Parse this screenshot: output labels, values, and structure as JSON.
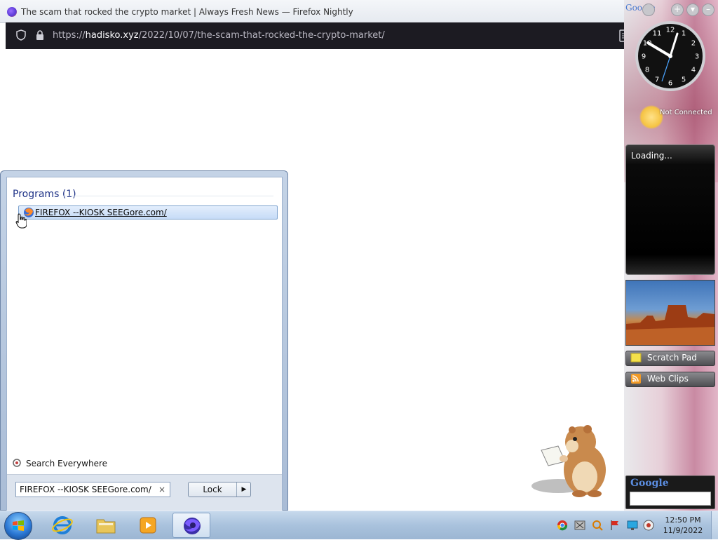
{
  "browser": {
    "window_title": "The scam that rocked the crypto market | Always Fresh News — Firefox Nightly",
    "url_prefix": "https://",
    "url_host": "hadisko.xyz",
    "url_path": "/2022/10/07/the-scam-that-rocked-the-crypto-market/"
  },
  "sidebar": {
    "google_tiny": "Google",
    "clock_numbers": [
      "12",
      "1",
      "2",
      "3",
      "4",
      "5",
      "6",
      "7",
      "8",
      "9",
      "10",
      "11"
    ],
    "weather_status": "Not Connected",
    "feed_status": "Loading...",
    "gadgets": [
      {
        "label": "Scratch Pad",
        "icon": "note-icon"
      },
      {
        "label": "Web Clips",
        "icon": "rss-icon"
      }
    ],
    "google_gadget_logo": "Google"
  },
  "start_menu": {
    "programs_heading": "Programs (1)",
    "program_item": "FIREFOX --KIOSK SEEGore.com/",
    "search_everywhere": "Search Everywhere",
    "search_value": "FIREFOX --KIOSK SEEGore.com/",
    "clear_glyph": "×",
    "lock_button": "Lock",
    "lock_arrow": "▶"
  },
  "taskbar": {
    "time": "12:50 PM",
    "date": "11/9/2022",
    "pinned": [
      "internet-explorer-icon",
      "folder-icon",
      "media-player-icon",
      "firefox-nightly-icon"
    ]
  },
  "colors": {
    "urlbar_bg": "#1c1b22",
    "sidebar_accent": "#c98aa3",
    "selection_border": "#7da2ce",
    "taskbar": "#a9c2dd"
  }
}
